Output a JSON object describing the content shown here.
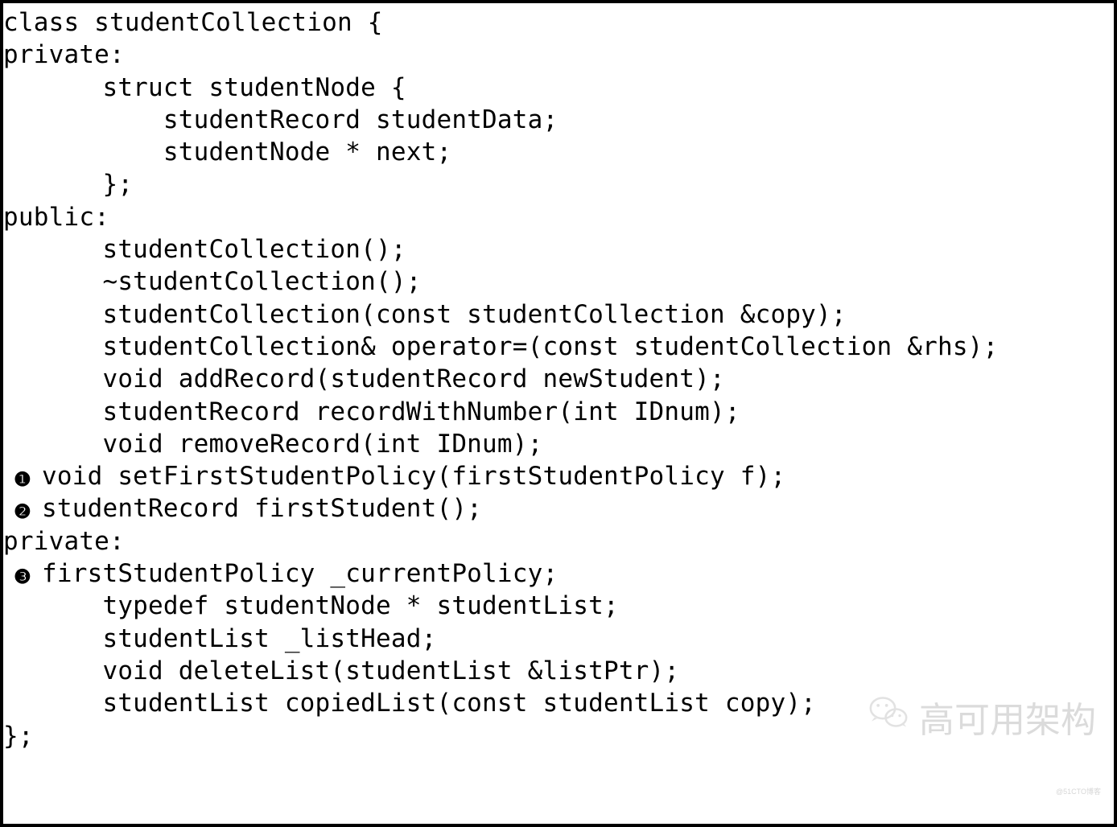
{
  "code": {
    "lines": [
      {
        "text": "class studentCollection {",
        "marker": null,
        "flush": true
      },
      {
        "text": "private:",
        "marker": null,
        "flush": true
      },
      {
        "text": "    struct studentNode {",
        "marker": null,
        "flush": false
      },
      {
        "text": "        studentRecord studentData;",
        "marker": null,
        "flush": false
      },
      {
        "text": "        studentNode * next;",
        "marker": null,
        "flush": false
      },
      {
        "text": "    };",
        "marker": null,
        "flush": false
      },
      {
        "text": "public:",
        "marker": null,
        "flush": true
      },
      {
        "text": "    studentCollection();",
        "marker": null,
        "flush": false
      },
      {
        "text": "    ~studentCollection();",
        "marker": null,
        "flush": false
      },
      {
        "text": "    studentCollection(const studentCollection &copy);",
        "marker": null,
        "flush": false
      },
      {
        "text": "    studentCollection& operator=(const studentCollection &rhs);",
        "marker": null,
        "flush": false
      },
      {
        "text": "    void addRecord(studentRecord newStudent);",
        "marker": null,
        "flush": false
      },
      {
        "text": "    studentRecord recordWithNumber(int IDnum);",
        "marker": null,
        "flush": false
      },
      {
        "text": "    void removeRecord(int IDnum);",
        "marker": null,
        "flush": false
      },
      {
        "text": "void setFirstStudentPolicy(firstStudentPolicy f);",
        "marker": "❶",
        "flush": false
      },
      {
        "text": "studentRecord firstStudent();",
        "marker": "❷",
        "flush": false
      },
      {
        "text": "private:",
        "marker": null,
        "flush": true
      },
      {
        "text": "firstStudentPolicy _currentPolicy;",
        "marker": "❸",
        "flush": false
      },
      {
        "text": "    typedef studentNode * studentList;",
        "marker": null,
        "flush": false
      },
      {
        "text": "    studentList _listHead;",
        "marker": null,
        "flush": false
      },
      {
        "text": "    void deleteList(studentList &listPtr);",
        "marker": null,
        "flush": false
      },
      {
        "text": "    studentList copiedList(const studentList copy);",
        "marker": null,
        "flush": false
      },
      {
        "text": "};",
        "marker": null,
        "flush": true
      }
    ]
  },
  "watermark": {
    "text": "高可用架构",
    "icon": "wechat-icon"
  },
  "tiny_mark": "@51CTO博客"
}
